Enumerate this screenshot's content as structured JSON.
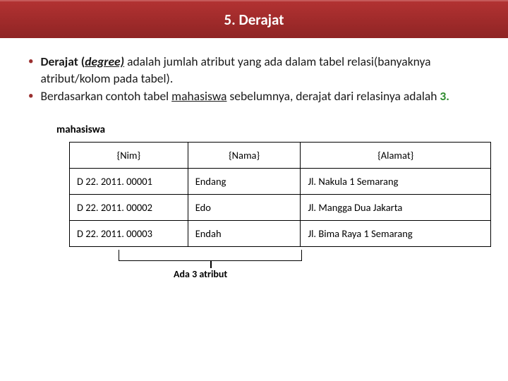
{
  "header": {
    "title": "5. Derajat"
  },
  "bullets": {
    "b1_bold": "Derajat (",
    "b1_ital": "degree)",
    "b1_rest": " adalah jumlah atribut yang ada dalam tabel relasi(banyaknya atribut/kolom pada tabel).",
    "b2_pre": "Berdasarkan contoh tabel ",
    "b2_under": "mahasiswa",
    "b2_mid": " sebelumnya, derajat dari relasinya adalah ",
    "b2_val": "3."
  },
  "table": {
    "label": "mahasiswa",
    "headers": {
      "nim": "{Nim}",
      "nama": "{Nama}",
      "alamat": "{Alamat}"
    },
    "rows": [
      {
        "nim": "D 22. 2011. 00001",
        "nama": "Endang",
        "alamat": "Jl. Nakula 1 Semarang"
      },
      {
        "nim": "D 22. 2011. 00002",
        "nama": "Edo",
        "alamat": "Jl. Mangga Dua  Jakarta"
      },
      {
        "nim": "D 22. 2011. 00003",
        "nama": "Endah",
        "alamat": "Jl. Bima Raya 1 Semarang"
      }
    ],
    "bracket_label": "Ada 3 atribut"
  }
}
